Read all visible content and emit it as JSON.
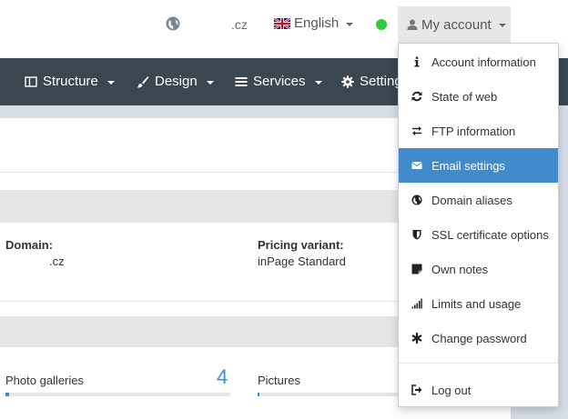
{
  "topbar": {
    "domain": ".cz",
    "language": "English",
    "my_account": "My account"
  },
  "nav": {
    "items": [
      {
        "label": "Structure",
        "icon": "structure-icon"
      },
      {
        "label": "Design",
        "icon": "brush-icon"
      },
      {
        "label": "Services",
        "icon": "list-icon"
      },
      {
        "label": "Settings",
        "icon": "gear-icon"
      }
    ]
  },
  "info": {
    "domain_label": "Domain:",
    "domain_value": ".cz",
    "pricing_label": "Pricing variant:",
    "pricing_value": "inPage Standard"
  },
  "stats": {
    "photo_galleries_label": "Photo galleries",
    "photo_galleries_count": "4",
    "photo_galleries_fill_percent": 1.5,
    "pictures_label": "Pictures",
    "pictures_fill_percent": 1.5
  },
  "dropdown": {
    "items": [
      {
        "label": "Account information",
        "icon": "info-icon"
      },
      {
        "label": "State of web",
        "icon": "refresh-icon"
      },
      {
        "label": "FTP information",
        "icon": "transfer-icon"
      },
      {
        "label": "Email settings",
        "icon": "envelope-icon",
        "active": true
      },
      {
        "label": "Domain aliases",
        "icon": "globe-icon"
      },
      {
        "label": "SSL certificate options",
        "icon": "shield-icon"
      },
      {
        "label": "Own notes",
        "icon": "note-icon"
      },
      {
        "label": "Limits and usage",
        "icon": "signal-icon"
      },
      {
        "label": "Change password",
        "icon": "asterisk-icon"
      },
      {
        "label": "Log out",
        "icon": "logout-icon"
      }
    ]
  },
  "colors": {
    "navbar": "#3a4650",
    "accent": "#428bca",
    "status_online": "#2ecc40"
  }
}
